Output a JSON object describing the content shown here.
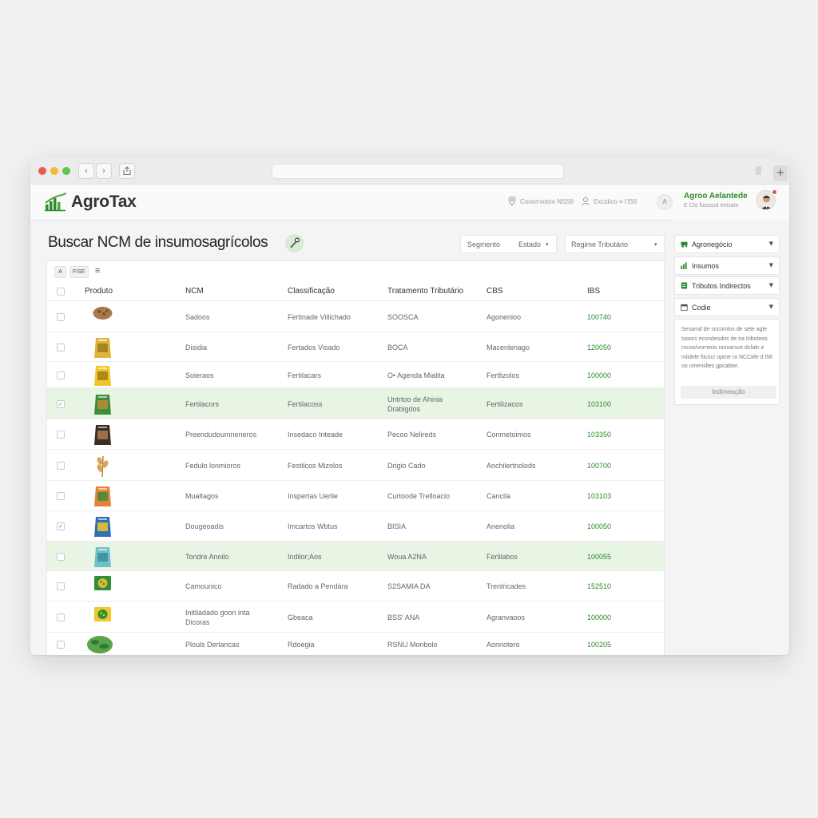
{
  "app": {
    "name": "AgroTax"
  },
  "header": {
    "item1": "Cooorrxotoo NSS8",
    "item2": "Excidico ≡ l'IS6",
    "circle": "A",
    "user_name": "Agroo Aelantede",
    "user_sub": "E Cfo fusussd entsato"
  },
  "page": {
    "title": "Buscar NCM de insumosagrícolos",
    "filter1_a": "Segmento",
    "filter1_b": "Estado",
    "filter2": "Regime Tributário"
  },
  "table": {
    "tools": [
      "A",
      "FISE",
      "≡"
    ],
    "columns": [
      "Produto",
      "NCM",
      "Classificação",
      "Tratamento Tributário",
      "CBS",
      "IBS"
    ],
    "rows": [
      {
        "name": "Sadoos",
        "classif": "Fertinade Villichado",
        "trat": "SOOSCA",
        "cbs": "Agonenioo",
        "ibs": "100740",
        "checked": false,
        "selected": false,
        "thumb": "seed-bag-icon"
      },
      {
        "name": "Disidia",
        "classif": "Fertados Visado",
        "trat": "BOCA",
        "cbs": "Macenlenago",
        "ibs": "120050",
        "checked": false,
        "selected": false,
        "thumb": "grain-bag-icon"
      },
      {
        "name": "Soieraos",
        "classif": "Fertilacars",
        "trat": "O• Agenda Mialita",
        "cbs": "Fertlizolos",
        "ibs": "100000",
        "checked": false,
        "selected": false,
        "thumb": "yellow-bag-icon"
      },
      {
        "name": "Fertilacors",
        "classif": "Fertilacoss",
        "trat": "Untrtoo de Ahinia Drabigdos",
        "cbs": "Fertilizacos",
        "ibs": "103100",
        "checked": true,
        "selected": true,
        "thumb": "green-bag-icon"
      },
      {
        "name": "Preendudoumneneros",
        "classif": "Insedaco Inteade",
        "trat": "Pecoo Nelireds",
        "cbs": "Conmetoimos",
        "ibs": "103350",
        "checked": false,
        "selected": false,
        "thumb": "dark-bag-icon"
      },
      {
        "name": "Fedulo lonmioros",
        "classif": "Festilcos Mizolos",
        "trat": "Drigio Cado",
        "cbs": "Anchilertnolods",
        "ibs": "100700",
        "checked": false,
        "selected": false,
        "thumb": "wheat-icon"
      },
      {
        "name": "Mualtagos",
        "classif": "Inspertas Uerlie",
        "trat": "Curtoode Trelloacio",
        "cbs": "Cancila",
        "ibs": "103103",
        "checked": false,
        "selected": false,
        "thumb": "orange-bag-icon"
      },
      {
        "name": "Dougeoadis",
        "classif": "Imcartos Wbtus",
        "trat": "BISIA",
        "cbs": "Anenolia",
        "ibs": "100050",
        "checked": true,
        "selected": false,
        "thumb": "blue-bag-icon"
      },
      {
        "name": "Tondre Anoilo",
        "classif": "Indilor;Aos",
        "trat": "Woua A2NA",
        "cbs": "Ferlilabos",
        "ibs": "100055",
        "checked": false,
        "selected": true,
        "thumb": "teal-bag-icon"
      },
      {
        "name": "Camounico",
        "classif": "Radado a Pendára",
        "trat": "S2SAMIA DA",
        "cbs": "Trenlricades",
        "ibs": "152510",
        "checked": false,
        "selected": false,
        "thumb": "green-box-icon"
      },
      {
        "name": "Initiladado goon inta Dicoras",
        "classif": "Gbeaca",
        "trat": "BSS' ANA",
        "cbs": "Agranvaoos",
        "ibs": "100000",
        "checked": false,
        "selected": false,
        "thumb": "yellow-box-icon"
      },
      {
        "name": "Plouls Derlancas",
        "classif": "Rdoegia",
        "trat": "RSNU Monbolo",
        "cbs": "Aonnotero",
        "ibs": "100205",
        "checked": false,
        "selected": false,
        "thumb": "herb-icon"
      }
    ]
  },
  "sidebar": {
    "items": [
      {
        "label": "Agronegócio",
        "icon": "tractor-icon"
      },
      {
        "label": "Insumos",
        "icon": "bar-chart-icon"
      },
      {
        "label": "Tributos Indirectos",
        "icon": "document-icon"
      },
      {
        "label": "Codie",
        "icon": "calendar-icon"
      }
    ],
    "info_text": "Sesamd de socomlos de sete agle Isoscs econdesdos de ira Iributeos rncoo/vnrnerio nrsvarsce dcfaln e miidele fiicocr optne ra NCCMe d l56 oo umenslles gpcabbe.",
    "info_button": "Indimeação"
  },
  "colors": {
    "accent": "#2c8a28",
    "selected_row": "#e8f4e4"
  }
}
